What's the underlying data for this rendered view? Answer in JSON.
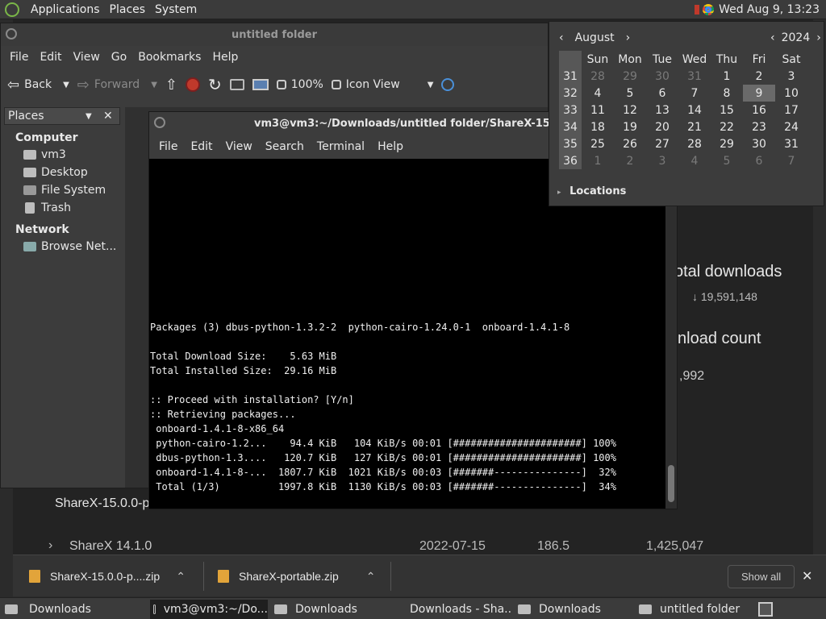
{
  "top_panel": {
    "menus": [
      "Applications",
      "Places",
      "System"
    ],
    "datetime": "Wed Aug  9, 13:23"
  },
  "file_manager": {
    "title": "untitled folder",
    "menu": [
      "File",
      "Edit",
      "View",
      "Go",
      "Bookmarks",
      "Help"
    ],
    "toolbar": {
      "back": "Back",
      "forward": "Forward",
      "zoom": "100%",
      "view_mode": "Icon View"
    },
    "sidebar": {
      "header": "Places",
      "computer_label": "Computer",
      "computer_items": [
        "vm3",
        "Desktop",
        "File System",
        "Trash"
      ],
      "network_label": "Network",
      "network_items": [
        "Browse Net..."
      ]
    }
  },
  "terminal": {
    "title": "vm3@vm3:~/Downloads/untitled folder/ShareX-15.0.0-por",
    "menu": [
      "File",
      "Edit",
      "View",
      "Search",
      "Terminal",
      "Help"
    ],
    "lines": [
      "Packages (3) dbus-python-1.3.2-2  python-cairo-1.24.0-1  onboard-1.4.1-8",
      "",
      "Total Download Size:    5.63 MiB",
      "Total Installed Size:  29.16 MiB",
      "",
      ":: Proceed with installation? [Y/n]",
      ":: Retrieving packages...",
      " onboard-1.4.1-8-x86_64",
      " python-cairo-1.2...    94.4 KiB   104 KiB/s 00:01 [######################] 100%",
      " dbus-python-1.3....   120.7 KiB   127 KiB/s 00:01 [######################] 100%",
      " onboard-1.4.1-8-...  1807.7 KiB  1021 KiB/s 00:03 [#######---------------]  32%",
      " Total (1/3)          1997.8 KiB  1130 KiB/s 00:03 [#######---------------]  34%"
    ]
  },
  "calendar": {
    "month": "August",
    "year": "2024",
    "weekdays": [
      "Sun",
      "Mon",
      "Tue",
      "Wed",
      "Thu",
      "Fri",
      "Sat"
    ],
    "weeks": [
      {
        "num": "31",
        "days": [
          "28",
          "29",
          "30",
          "31",
          "1",
          "2",
          "3"
        ]
      },
      {
        "num": "32",
        "days": [
          "4",
          "5",
          "6",
          "7",
          "8",
          "9",
          "10"
        ]
      },
      {
        "num": "33",
        "days": [
          "11",
          "12",
          "13",
          "14",
          "15",
          "16",
          "17"
        ]
      },
      {
        "num": "34",
        "days": [
          "18",
          "19",
          "20",
          "21",
          "22",
          "23",
          "24"
        ]
      },
      {
        "num": "35",
        "days": [
          "25",
          "26",
          "27",
          "28",
          "29",
          "30",
          "31"
        ]
      },
      {
        "num": "36",
        "days": [
          "1",
          "2",
          "3",
          "4",
          "5",
          "6",
          "7"
        ]
      }
    ],
    "locations_label": "Locations"
  },
  "browser_page": {
    "total_downloads_heading": "otal downloads",
    "total_downloads_value": "19,591,148",
    "download_count_heading": "nload count",
    "download_count_value": ",992",
    "release_name": "ShareX-15.0.0-p",
    "row": {
      "name": "ShareX 14.1.0",
      "date": "2022-07-15",
      "size": "186.5",
      "downloads": "1,425,047"
    }
  },
  "downloads_bar": {
    "items": [
      "ShareX-15.0.0-p....zip",
      "ShareX-portable.zip"
    ],
    "show_all": "Show all"
  },
  "taskbar": {
    "items": [
      "Downloads",
      "vm3@vm3:~/Do...",
      "Downloads",
      "Downloads - Sha...",
      "Downloads",
      "untitled folder"
    ]
  }
}
